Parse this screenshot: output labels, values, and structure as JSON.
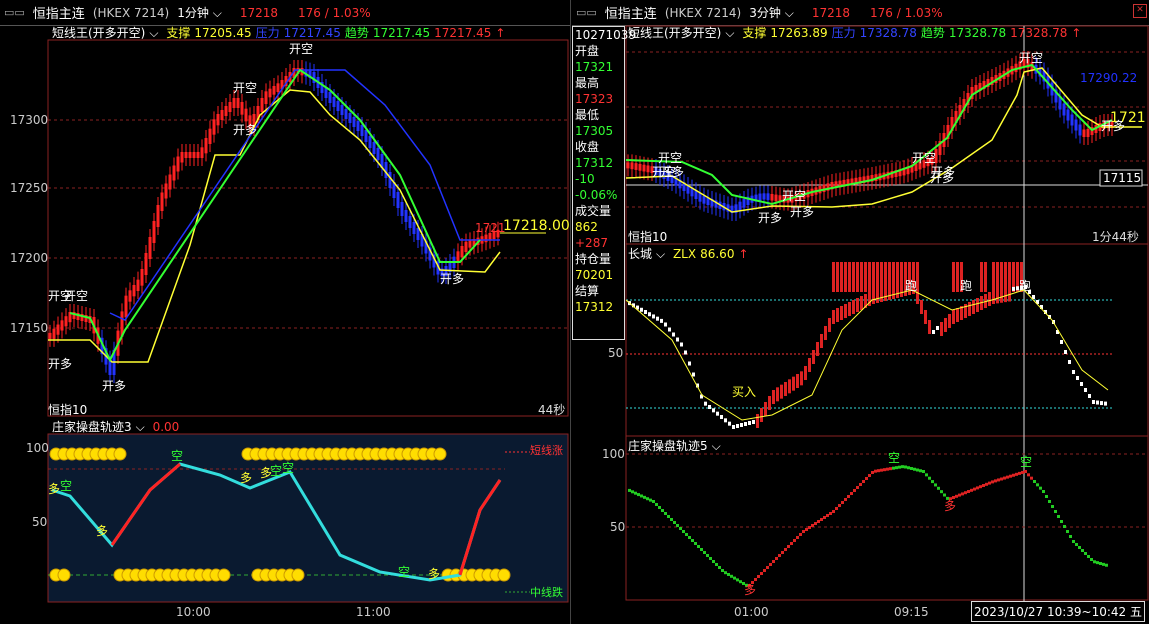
{
  "left": {
    "window": {
      "icon": "window-icon",
      "title": "恒指主连",
      "code": "(HKEX 7214)",
      "period": "1分钟",
      "price": "17218",
      "change": "176 / 1.03%"
    },
    "main_legend": {
      "indicator": "短线王(开多开空)",
      "support_label": "支撑",
      "support": "17205.45",
      "resistance_label": "压力",
      "resistance": "17217.45",
      "trend_label": "趋势",
      "trend": "17217.45",
      "extra": "17217.45"
    },
    "price_axis": [
      "17300",
      "17250",
      "17200",
      "17150"
    ],
    "last_price": "17218.00",
    "last_small": "1721",
    "bottom_left": "恒指10",
    "bottom_right": "44秒",
    "signals": [
      "开空",
      "开空",
      "开多",
      "开空",
      "开多",
      "开空",
      "开多",
      "开多"
    ],
    "sub_legend": {
      "indicator": "庄家操盘轨迹3",
      "value": "0.00"
    },
    "sub_axis": [
      "100",
      "50"
    ],
    "sub_right_top": "短线涨",
    "sub_right_bottom": "中线跌",
    "time_axis": [
      "10:00",
      "11:00"
    ],
    "sub_signals": [
      "多",
      "空",
      "空",
      "多",
      "多",
      "空",
      "空",
      "多",
      "空",
      "多"
    ]
  },
  "right": {
    "window": {
      "icon": "window-icon",
      "title": "恒指主连",
      "code": "(HKEX 7214)",
      "period": "3分钟",
      "price": "17218",
      "change": "176 / 1.03%"
    },
    "main_legend": {
      "indicator": "短线王(开多开空)",
      "support_label": "支撑",
      "support": "17263.89",
      "resistance_label": "压力",
      "resistance": "17328.78",
      "trend_label": "趋势",
      "trend": "17328.78",
      "extra": "17328.78"
    },
    "info": {
      "date": "10271039",
      "open_label": "开盘",
      "open": "17321",
      "high_label": "最高",
      "high": "17323",
      "low_label": "最低",
      "low": "17305",
      "close_label": "收盘",
      "close": "17312",
      "chg": "-10",
      "chg_pct": "-0.06%",
      "vol_label": "成交量",
      "vol": "862",
      "vol_chg": "+287",
      "oi_label": "持仓量",
      "oi": "70201",
      "settle_label": "结算",
      "settle": "17312"
    },
    "crosshair_price": "17115",
    "right_price": "1721",
    "right_value": "17290.22",
    "bottom_left": "恒指10",
    "bottom_right": "1分44秒",
    "signals": [
      "开空",
      "开空",
      "开空",
      "开多",
      "开多",
      "开空",
      "开多",
      "开多",
      "开空",
      "开多",
      "开多"
    ],
    "mid_legend": {
      "indicator": "长城",
      "name": "ZLX",
      "value": "86.60"
    },
    "mid_axis": [
      "50"
    ],
    "mid_signals": [
      "买入",
      "跑",
      "跑",
      "跑"
    ],
    "sub_legend": {
      "indicator": "庄家操盘轨迹5"
    },
    "sub_axis": [
      "100",
      "50"
    ],
    "sub_signals": [
      "空",
      "空",
      "多",
      "多"
    ],
    "time_axis": [
      "01:00",
      "09:15"
    ],
    "datetime": "2023/10/27 10:39~10:42 五"
  }
}
